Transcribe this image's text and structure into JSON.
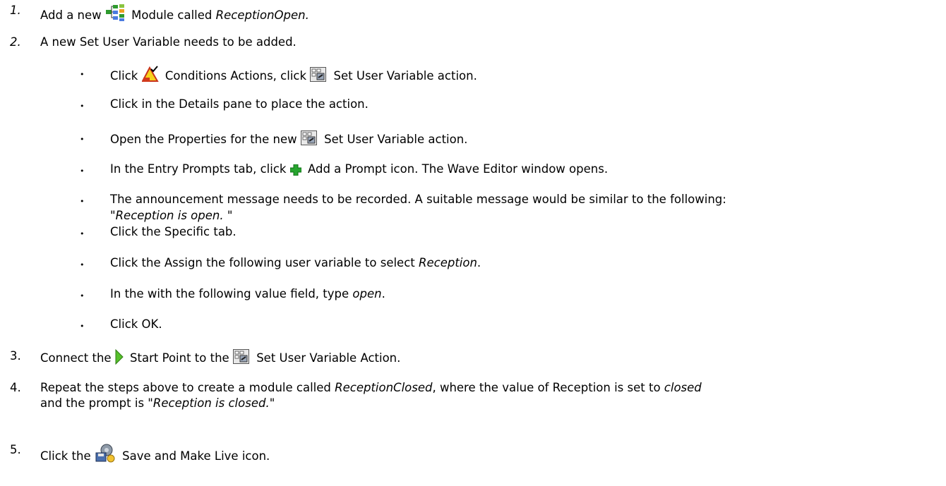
{
  "steps": [
    {
      "num": "1.",
      "pre": "Add a new",
      "post": "Module called",
      "italic": "ReceptionOpen."
    },
    {
      "num": "2.",
      "text": "A new Set User Variable needs to be added."
    },
    {
      "num": "3.",
      "pre": "Connect the",
      "mid": "Start Point to the",
      "post": "Set User Variable Action."
    },
    {
      "num": "4.",
      "line1_pre": "Repeat the steps above to create a module called",
      "line1_it1": "ReceptionClosed",
      "line1_mid": ", where the value of Reception is set to",
      "line1_it2": "closed",
      "line2_pre": "and the prompt is",
      "line2_it": "\"Reception is closed.\""
    },
    {
      "num": "5.",
      "pre": "Click the",
      "post": "Save and Make Live icon."
    }
  ],
  "bullets": [
    {
      "pre": "Click",
      "mid": "Conditions Actions, click",
      "post": "Set User Variable action."
    },
    {
      "text": "Click in the Details pane to place the action."
    },
    {
      "pre": "Open the Properties for the new",
      "post": "Set User Variable action."
    },
    {
      "pre": "In the Entry Prompts tab, click",
      "post": "Add a Prompt icon. The Wave Editor window opens."
    },
    {
      "line1": "The announcement message needs to be recorded. A suitable message would be similar to the following:",
      "line2": "\"Reception is open. \""
    },
    {
      "text": "Click the Specific tab."
    },
    {
      "pre": "Click the Assign the following user variable to select",
      "italic": "Reception",
      "post": "."
    },
    {
      "pre": "In the with the following value field, type",
      "italic": "open",
      "post": "."
    },
    {
      "text": "Click OK."
    }
  ],
  "bullet_char": "•",
  "icons": [
    "module-icon",
    "conditions-actions-icon",
    "set-user-variable-icon",
    "add-prompt-icon",
    "start-point-icon",
    "save-make-live-icon"
  ]
}
